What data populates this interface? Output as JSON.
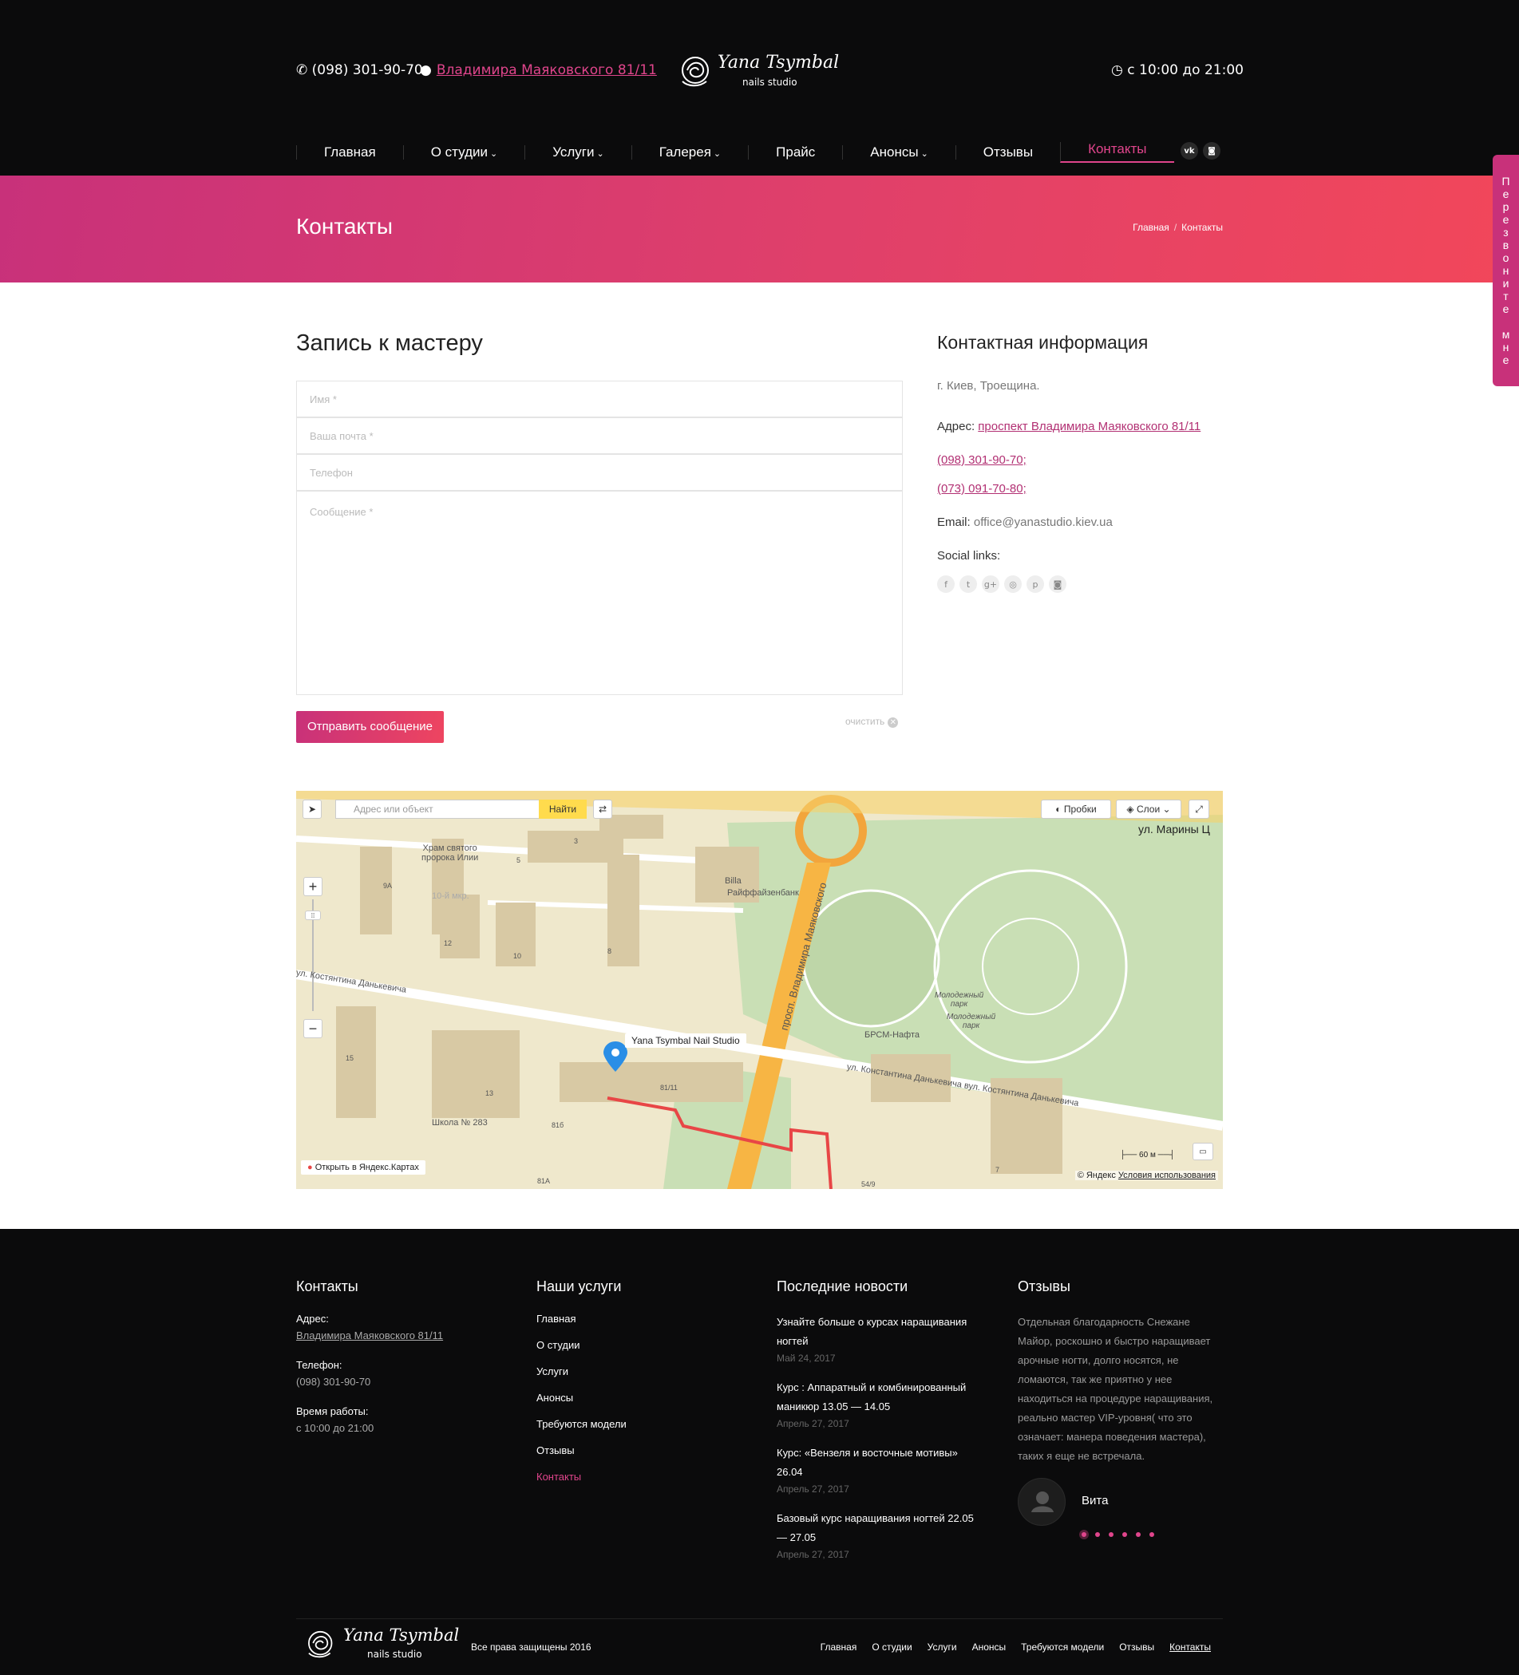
{
  "header": {
    "phone": "(098) 301-90-70",
    "address": "Владимира Маяковского 81/11",
    "logo_script": "Yana Tsymbal",
    "logo_sub": "nails studio",
    "hours": "с 10:00 до 21:00"
  },
  "nav": {
    "items": [
      {
        "label": "Главная"
      },
      {
        "label": "О студии"
      },
      {
        "label": "Услуги"
      },
      {
        "label": "Галерея"
      },
      {
        "label": "Прайс"
      },
      {
        "label": "Анонсы"
      },
      {
        "label": "Отзывы"
      },
      {
        "label": "Контакты"
      }
    ],
    "social": [
      "vk-icon",
      "instagram-icon"
    ]
  },
  "band": {
    "title": "Контакты",
    "crumb_home": "Главная",
    "crumb_sep": "/",
    "crumb_current": "Контакты"
  },
  "callback_tab": "Перезвоните мне",
  "form": {
    "title": "Запись к мастеру",
    "name_placeholder": "Имя *",
    "email_placeholder": "Ваша почта *",
    "phone_placeholder": "Телефон",
    "message_placeholder": "Сообщение *",
    "submit": "Отправить сообщение",
    "clear": "очистить"
  },
  "contact_info": {
    "title": "Контактная информация",
    "city": "г. Киев, Троещина.",
    "address_label": "Адрес:",
    "address": "проспект Владимира Маяковского 81/11",
    "phone1": "(098) 301-90-70;",
    "phone2": "(073) 091-70-80;",
    "email_label": "Email:",
    "email": "office@yanastudio.kiev.ua",
    "social_label": "Social links:",
    "social_icons": [
      "facebook-icon",
      "twitter-icon",
      "google-plus-icon",
      "dribbble-icon",
      "pinterest-icon",
      "instagram-icon"
    ]
  },
  "map": {
    "search_placeholder": "Адрес или объект",
    "find": "Найти",
    "traffic": "Пробки",
    "layers": "Слои",
    "pin_label": "Yana Tsymbal Nail Studio",
    "open_link": "Открыть в Яндекс.Картах",
    "copyright": "© Яндекс",
    "terms": "Условия использования",
    "scale": "60 м",
    "labels": {
      "church": "Храм святого\nпророка Илии",
      "mkr": "10-й мкр.",
      "bank": "Райффайзенбанк",
      "billa": "Billa",
      "park": "Молодежный\nпарк",
      "park2": "Молодежный\nпарк",
      "fuel": "БРСМ-Нафта",
      "school": "Школа № 283",
      "street1": "ул. Костянтина Данькевича",
      "street2": "ул. Константина Данькевича вул. Костянтина Данькевича",
      "avenue": "просп. Владимира Маяковского",
      "street3": "ул. Марины Ц",
      "n3": "3",
      "n5": "5",
      "n8": "8",
      "n9a": "9А",
      "n12": "12",
      "n10": "10",
      "n15": "15",
      "n13": "13",
      "n81": "81/11",
      "n816": "81б",
      "n81a": "81А",
      "n549": "54/9",
      "n7": "7"
    }
  },
  "footer": {
    "contacts": {
      "title": "Контакты",
      "addr_label": "Адрес:",
      "addr": "Владимира Маяковского 81/11",
      "tel_label": "Телефон:",
      "tel": "(098) 301-90-70",
      "hours_label": "Время работы:",
      "hours": "с 10:00 до 21:00"
    },
    "services": {
      "title": "Наши услуги",
      "links": [
        "Главная",
        "О студии",
        "Услуги",
        "Анонсы",
        "Требуются модели",
        "Отзывы",
        "Контакты"
      ]
    },
    "news": {
      "title": "Последние новости",
      "items": [
        {
          "title": "Узнайте больше о курсах наращивания ногтей",
          "date": "Май 24, 2017"
        },
        {
          "title": "Курс : Аппаратный и комбинированный маникюр 13.05 — 14.05",
          "date": "Апрель 27, 2017"
        },
        {
          "title": "Курс: «Вензеля и восточные мотивы» 26.04",
          "date": "Апрель 27, 2017"
        },
        {
          "title": "Базовый курс наращивания ногтей 22.05 — 27.05",
          "date": "Апрель 27, 2017"
        }
      ]
    },
    "reviews": {
      "title": "Отзывы",
      "text": "Отдельная благодарность Снежане Майор, роскошно и быстро наращивает арочные ногти, долго носятся, не ломаются, так же приятно у нее находиться на процедуре наращивания, реально мастер VIP-уровня( что это означает: манера поведения мастера), таких я еще не встречала.",
      "name": "Вита"
    },
    "copyright": "Все права защищены 2016",
    "bottom_nav": [
      "Главная",
      "О студии",
      "Услуги",
      "Анонсы",
      "Требуются модели",
      "Отзывы",
      "Контакты"
    ]
  },
  "colors": {
    "accent": "#e0458c",
    "band_start": "#c8317a",
    "band_end": "#f2475a",
    "dark": "#0b0b0c"
  }
}
